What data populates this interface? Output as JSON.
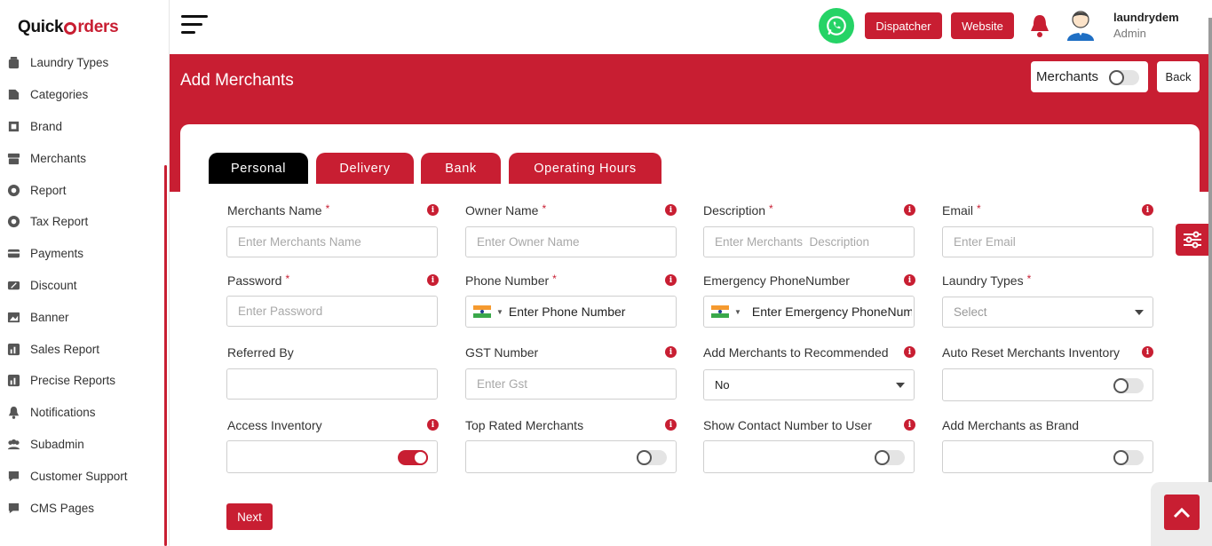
{
  "brand": {
    "logo_left": "Quick",
    "logo_right": "rders",
    "accent_color": "#c81e32"
  },
  "sidebar": {
    "items": [
      {
        "label": "Laundry Types",
        "icon": "laundry-icon"
      },
      {
        "label": "Categories",
        "icon": "categories-icon"
      },
      {
        "label": "Brand",
        "icon": "brand-icon"
      },
      {
        "label": "Merchants",
        "icon": "merchants-icon"
      },
      {
        "label": "Report",
        "icon": "report-icon"
      },
      {
        "label": "Tax Report",
        "icon": "tax-report-icon"
      },
      {
        "label": "Payments",
        "icon": "payments-icon"
      },
      {
        "label": "Discount",
        "icon": "discount-icon"
      },
      {
        "label": "Banner",
        "icon": "banner-icon"
      },
      {
        "label": "Sales Report",
        "icon": "sales-report-icon"
      },
      {
        "label": "Precise Reports",
        "icon": "precise-reports-icon"
      },
      {
        "label": "Notifications",
        "icon": "bell-icon"
      },
      {
        "label": "Subadmin",
        "icon": "subadmin-icon"
      },
      {
        "label": "Customer Support",
        "icon": "support-icon"
      },
      {
        "label": "CMS Pages",
        "icon": "cms-icon"
      }
    ]
  },
  "header": {
    "dispatcher_label": "Dispatcher",
    "website_label": "Website",
    "user_name": "laundrydem",
    "user_role": "Admin"
  },
  "page": {
    "title": "Add Merchants",
    "toggle_label": "Merchants",
    "back_label": "Back"
  },
  "tabs": [
    "Personal",
    "Delivery",
    "Bank",
    "Operating Hours"
  ],
  "form": {
    "merchants_name": {
      "label": "Merchants Name",
      "placeholder": "Enter Merchants Name"
    },
    "owner_name": {
      "label": "Owner Name",
      "placeholder": "Enter Owner Name"
    },
    "description": {
      "label": "Description",
      "placeholder": "Enter Merchants  Description"
    },
    "email": {
      "label": "Email",
      "placeholder": "Enter Email"
    },
    "password": {
      "label": "Password",
      "placeholder": "Enter Password"
    },
    "phone": {
      "label": "Phone Number",
      "placeholder": "Enter Phone Number"
    },
    "emergency_phone": {
      "label": "Emergency PhoneNumber",
      "placeholder": "Enter Emergency PhoneNumber"
    },
    "laundry_types": {
      "label": "Laundry Types",
      "value": "Select"
    },
    "referred_by": {
      "label": "Referred By",
      "placeholder": ""
    },
    "gst": {
      "label": "GST Number",
      "placeholder": "Enter Gst"
    },
    "recommended": {
      "label": "Add Merchants to Recommended",
      "value": "No"
    },
    "auto_reset": {
      "label": "Auto Reset Merchants Inventory"
    },
    "access_inventory": {
      "label": "Access Inventory"
    },
    "top_rated": {
      "label": "Top Rated Merchants"
    },
    "show_contact": {
      "label": "Show Contact Number to User"
    },
    "add_as_brand": {
      "label": "Add Merchants as Brand"
    },
    "required_mark": "*",
    "info_mark": "i",
    "next_label": "Next"
  }
}
